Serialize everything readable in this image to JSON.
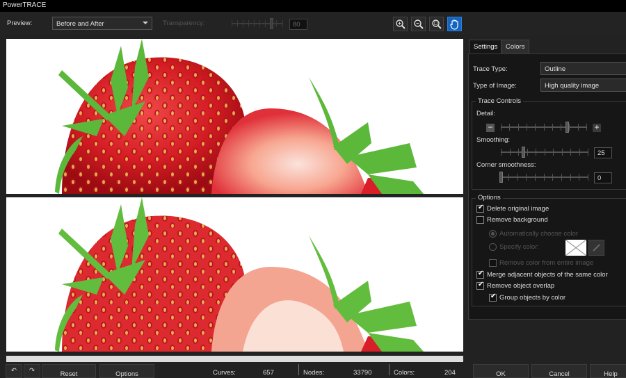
{
  "window": {
    "title": "PowerTRACE"
  },
  "toolbar": {
    "preview_label": "Preview:",
    "preview_value": "Before and After",
    "transparency_label": "Transparency:",
    "transparency_value": "80",
    "transparency_level_percent": 80,
    "tools": [
      {
        "name": "zoom-in",
        "icon": "zoom-in-icon",
        "active": false
      },
      {
        "name": "zoom-out",
        "icon": "zoom-out-icon",
        "active": false
      },
      {
        "name": "zoom-fit",
        "icon": "zoom-fit-icon",
        "active": false
      },
      {
        "name": "pan",
        "icon": "hand-icon",
        "active": true
      }
    ]
  },
  "preview": {
    "before_description": "Original photo of strawberries",
    "after_description": "Traced vector result of strawberries"
  },
  "tabs": [
    {
      "label": "Settings",
      "selected": true
    },
    {
      "label": "Colors",
      "selected": false
    }
  ],
  "settings": {
    "trace_type_label": "Trace Type:",
    "trace_type_value": "Outline",
    "image_type_label": "Type of Image:",
    "image_type_value": "High quality image",
    "trace_controls": {
      "title": "Trace Controls",
      "detail_label": "Detail:",
      "detail_level_percent": 78,
      "smoothing_label": "Smoothing:",
      "smoothing_value": "25",
      "corner_label": "Corner smoothness:",
      "corner_value": "0"
    },
    "options": {
      "title": "Options",
      "delete_original": {
        "label": "Delete original image",
        "checked": true
      },
      "remove_background": {
        "label": "Remove background",
        "checked": false
      },
      "auto_color": {
        "label": "Automatically choose color",
        "selected": true,
        "disabled": true
      },
      "specify_color": {
        "label": "Specify color:",
        "selected": false,
        "disabled": true
      },
      "remove_color_entire": {
        "label": "Remove color from entire image",
        "checked": false,
        "disabled": true
      },
      "merge_adjacent": {
        "label": "Merge adjacent objects of the same color",
        "checked": true
      },
      "remove_overlap": {
        "label": "Remove object overlap",
        "checked": true
      },
      "group_by_color": {
        "label": "Group objects by color",
        "checked": true
      }
    }
  },
  "footer": {
    "undo_icon": "undo-icon",
    "redo_icon": "redo-icon",
    "reset_label": "Reset",
    "options_label": "Options",
    "curves_label": "Curves:",
    "curves_value": "657",
    "nodes_label": "Nodes:",
    "nodes_value": "33790",
    "colors_label": "Colors:",
    "colors_value": "204",
    "ok_label": "OK",
    "cancel_label": "Cancel",
    "help_label": "Help"
  }
}
